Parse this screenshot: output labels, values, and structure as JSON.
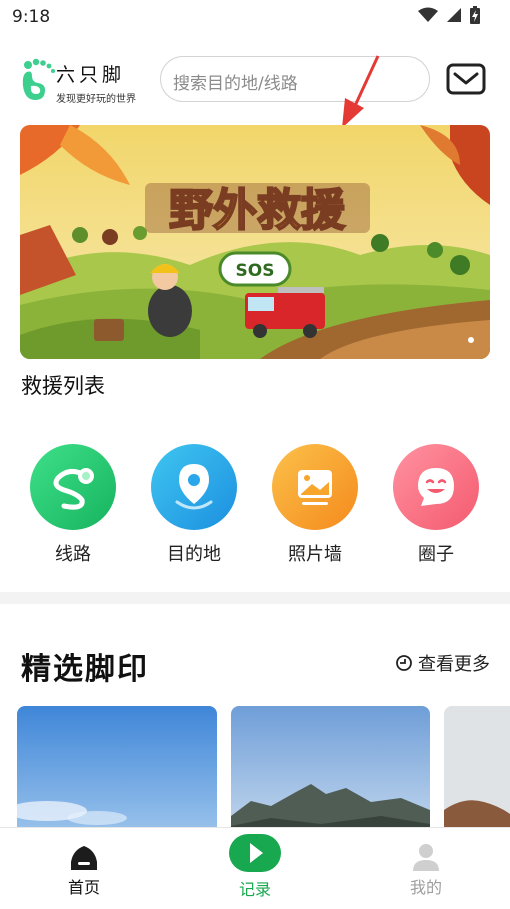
{
  "status_bar": {
    "time": "9:18"
  },
  "header": {
    "brand_name": "六只脚",
    "brand_slogan": "发现更好玩的世界",
    "search_placeholder": "搜索目的地/线路"
  },
  "banner": {
    "title": "野外救援",
    "badge": "SOS"
  },
  "rescue_list_title": "救援列表",
  "categories": [
    {
      "label": "线路",
      "icon": "route-icon",
      "color": "#1fc16b"
    },
    {
      "label": "目的地",
      "icon": "location-pin-icon",
      "color": "#2aa6ea"
    },
    {
      "label": "照片墙",
      "icon": "photo-icon",
      "color": "#f7a52b"
    },
    {
      "label": "圈子",
      "icon": "smile-chat-icon",
      "color": "#fa6a7c"
    }
  ],
  "featured": {
    "title": "精选脚印",
    "see_more": "查看更多"
  },
  "tabbar": {
    "items": [
      {
        "label": "首页",
        "icon": "home-icon",
        "active": true
      },
      {
        "label": "记录",
        "icon": "record-play-icon",
        "active": false
      },
      {
        "label": "我的",
        "icon": "profile-icon",
        "active": false
      }
    ],
    "accent": "#18a84f"
  }
}
